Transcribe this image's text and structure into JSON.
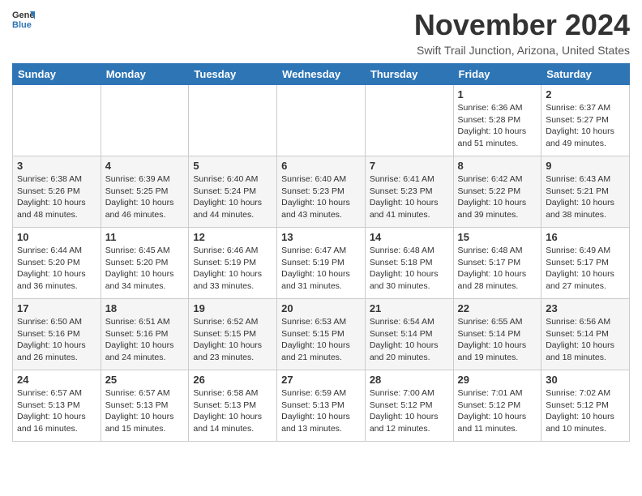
{
  "header": {
    "logo_general": "General",
    "logo_blue": "Blue",
    "month": "November 2024",
    "location": "Swift Trail Junction, Arizona, United States"
  },
  "days_of_week": [
    "Sunday",
    "Monday",
    "Tuesday",
    "Wednesday",
    "Thursday",
    "Friday",
    "Saturday"
  ],
  "weeks": [
    [
      {
        "day": "",
        "info": ""
      },
      {
        "day": "",
        "info": ""
      },
      {
        "day": "",
        "info": ""
      },
      {
        "day": "",
        "info": ""
      },
      {
        "day": "",
        "info": ""
      },
      {
        "day": "1",
        "info": "Sunrise: 6:36 AM\nSunset: 5:28 PM\nDaylight: 10 hours\nand 51 minutes."
      },
      {
        "day": "2",
        "info": "Sunrise: 6:37 AM\nSunset: 5:27 PM\nDaylight: 10 hours\nand 49 minutes."
      }
    ],
    [
      {
        "day": "3",
        "info": "Sunrise: 6:38 AM\nSunset: 5:26 PM\nDaylight: 10 hours\nand 48 minutes."
      },
      {
        "day": "4",
        "info": "Sunrise: 6:39 AM\nSunset: 5:25 PM\nDaylight: 10 hours\nand 46 minutes."
      },
      {
        "day": "5",
        "info": "Sunrise: 6:40 AM\nSunset: 5:24 PM\nDaylight: 10 hours\nand 44 minutes."
      },
      {
        "day": "6",
        "info": "Sunrise: 6:40 AM\nSunset: 5:23 PM\nDaylight: 10 hours\nand 43 minutes."
      },
      {
        "day": "7",
        "info": "Sunrise: 6:41 AM\nSunset: 5:23 PM\nDaylight: 10 hours\nand 41 minutes."
      },
      {
        "day": "8",
        "info": "Sunrise: 6:42 AM\nSunset: 5:22 PM\nDaylight: 10 hours\nand 39 minutes."
      },
      {
        "day": "9",
        "info": "Sunrise: 6:43 AM\nSunset: 5:21 PM\nDaylight: 10 hours\nand 38 minutes."
      }
    ],
    [
      {
        "day": "10",
        "info": "Sunrise: 6:44 AM\nSunset: 5:20 PM\nDaylight: 10 hours\nand 36 minutes."
      },
      {
        "day": "11",
        "info": "Sunrise: 6:45 AM\nSunset: 5:20 PM\nDaylight: 10 hours\nand 34 minutes."
      },
      {
        "day": "12",
        "info": "Sunrise: 6:46 AM\nSunset: 5:19 PM\nDaylight: 10 hours\nand 33 minutes."
      },
      {
        "day": "13",
        "info": "Sunrise: 6:47 AM\nSunset: 5:19 PM\nDaylight: 10 hours\nand 31 minutes."
      },
      {
        "day": "14",
        "info": "Sunrise: 6:48 AM\nSunset: 5:18 PM\nDaylight: 10 hours\nand 30 minutes."
      },
      {
        "day": "15",
        "info": "Sunrise: 6:48 AM\nSunset: 5:17 PM\nDaylight: 10 hours\nand 28 minutes."
      },
      {
        "day": "16",
        "info": "Sunrise: 6:49 AM\nSunset: 5:17 PM\nDaylight: 10 hours\nand 27 minutes."
      }
    ],
    [
      {
        "day": "17",
        "info": "Sunrise: 6:50 AM\nSunset: 5:16 PM\nDaylight: 10 hours\nand 26 minutes."
      },
      {
        "day": "18",
        "info": "Sunrise: 6:51 AM\nSunset: 5:16 PM\nDaylight: 10 hours\nand 24 minutes."
      },
      {
        "day": "19",
        "info": "Sunrise: 6:52 AM\nSunset: 5:15 PM\nDaylight: 10 hours\nand 23 minutes."
      },
      {
        "day": "20",
        "info": "Sunrise: 6:53 AM\nSunset: 5:15 PM\nDaylight: 10 hours\nand 21 minutes."
      },
      {
        "day": "21",
        "info": "Sunrise: 6:54 AM\nSunset: 5:14 PM\nDaylight: 10 hours\nand 20 minutes."
      },
      {
        "day": "22",
        "info": "Sunrise: 6:55 AM\nSunset: 5:14 PM\nDaylight: 10 hours\nand 19 minutes."
      },
      {
        "day": "23",
        "info": "Sunrise: 6:56 AM\nSunset: 5:14 PM\nDaylight: 10 hours\nand 18 minutes."
      }
    ],
    [
      {
        "day": "24",
        "info": "Sunrise: 6:57 AM\nSunset: 5:13 PM\nDaylight: 10 hours\nand 16 minutes."
      },
      {
        "day": "25",
        "info": "Sunrise: 6:57 AM\nSunset: 5:13 PM\nDaylight: 10 hours\nand 15 minutes."
      },
      {
        "day": "26",
        "info": "Sunrise: 6:58 AM\nSunset: 5:13 PM\nDaylight: 10 hours\nand 14 minutes."
      },
      {
        "day": "27",
        "info": "Sunrise: 6:59 AM\nSunset: 5:13 PM\nDaylight: 10 hours\nand 13 minutes."
      },
      {
        "day": "28",
        "info": "Sunrise: 7:00 AM\nSunset: 5:12 PM\nDaylight: 10 hours\nand 12 minutes."
      },
      {
        "day": "29",
        "info": "Sunrise: 7:01 AM\nSunset: 5:12 PM\nDaylight: 10 hours\nand 11 minutes."
      },
      {
        "day": "30",
        "info": "Sunrise: 7:02 AM\nSunset: 5:12 PM\nDaylight: 10 hours\nand 10 minutes."
      }
    ]
  ]
}
